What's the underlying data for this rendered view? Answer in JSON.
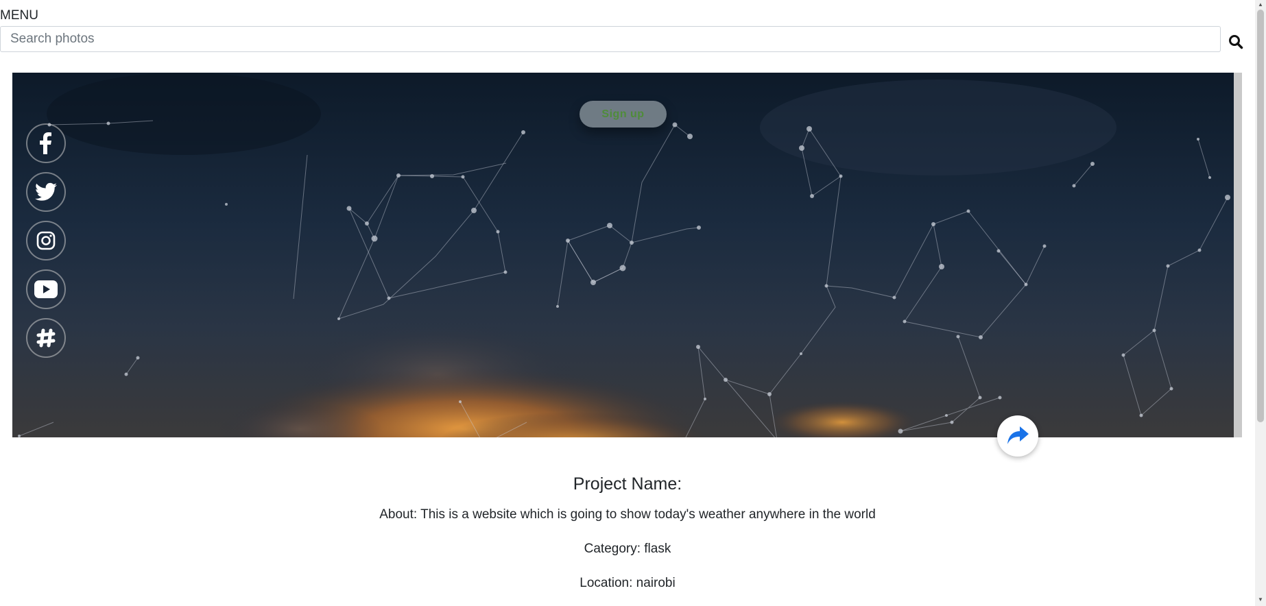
{
  "header": {
    "menu_label": "MENU",
    "search_placeholder": "Search photos",
    "search_icon": "search-icon"
  },
  "hero": {
    "signup_label": "Sign up",
    "social_icons": [
      "facebook-icon",
      "twitter-icon",
      "instagram-icon",
      "youtube-icon",
      "slack-icon"
    ],
    "share_icon": "share-icon"
  },
  "project": {
    "title": "Project Name:",
    "about": "About: This is a website which is going to show today's weather anywhere in the world",
    "category": "Category: flask",
    "location": "Location: nairobi"
  },
  "colors": {
    "signup_text": "#4f8c3a",
    "share_icon": "#1a73e8"
  }
}
